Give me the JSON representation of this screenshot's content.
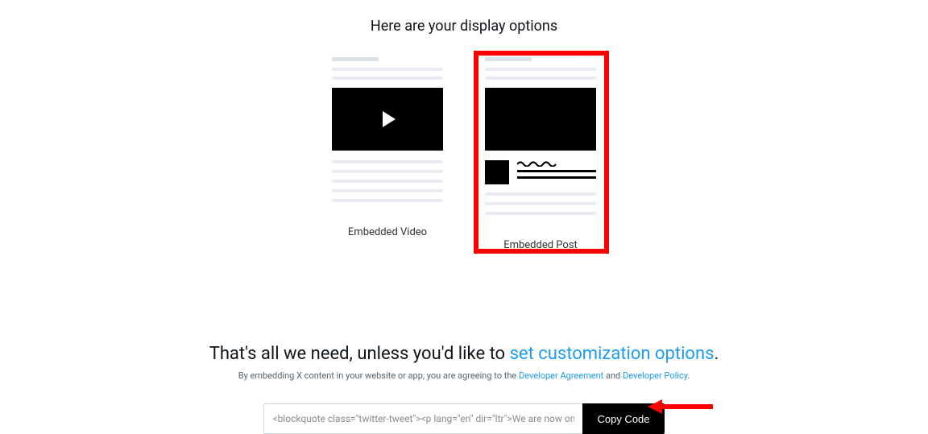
{
  "heading": "Here are your display options",
  "options": {
    "video": {
      "label": "Embedded Video"
    },
    "post": {
      "label": "Embedded Post"
    }
  },
  "subsection": {
    "prefix": "That's all we need, unless you'd like to ",
    "link": "set customization options",
    "suffix": "."
  },
  "fineprint": {
    "prefix": "By embedding X content in your website or app, you are agreeing to the ",
    "link1": "Developer Agreement",
    "mid": " and ",
    "link2": "Developer Policy",
    "suffix": "."
  },
  "embed": {
    "code": "<blockquote class=\"twitter-tweet\"><p lang=\"en\" dir=\"ltr\">We are now on ",
    "copy_label": "Copy Code"
  }
}
